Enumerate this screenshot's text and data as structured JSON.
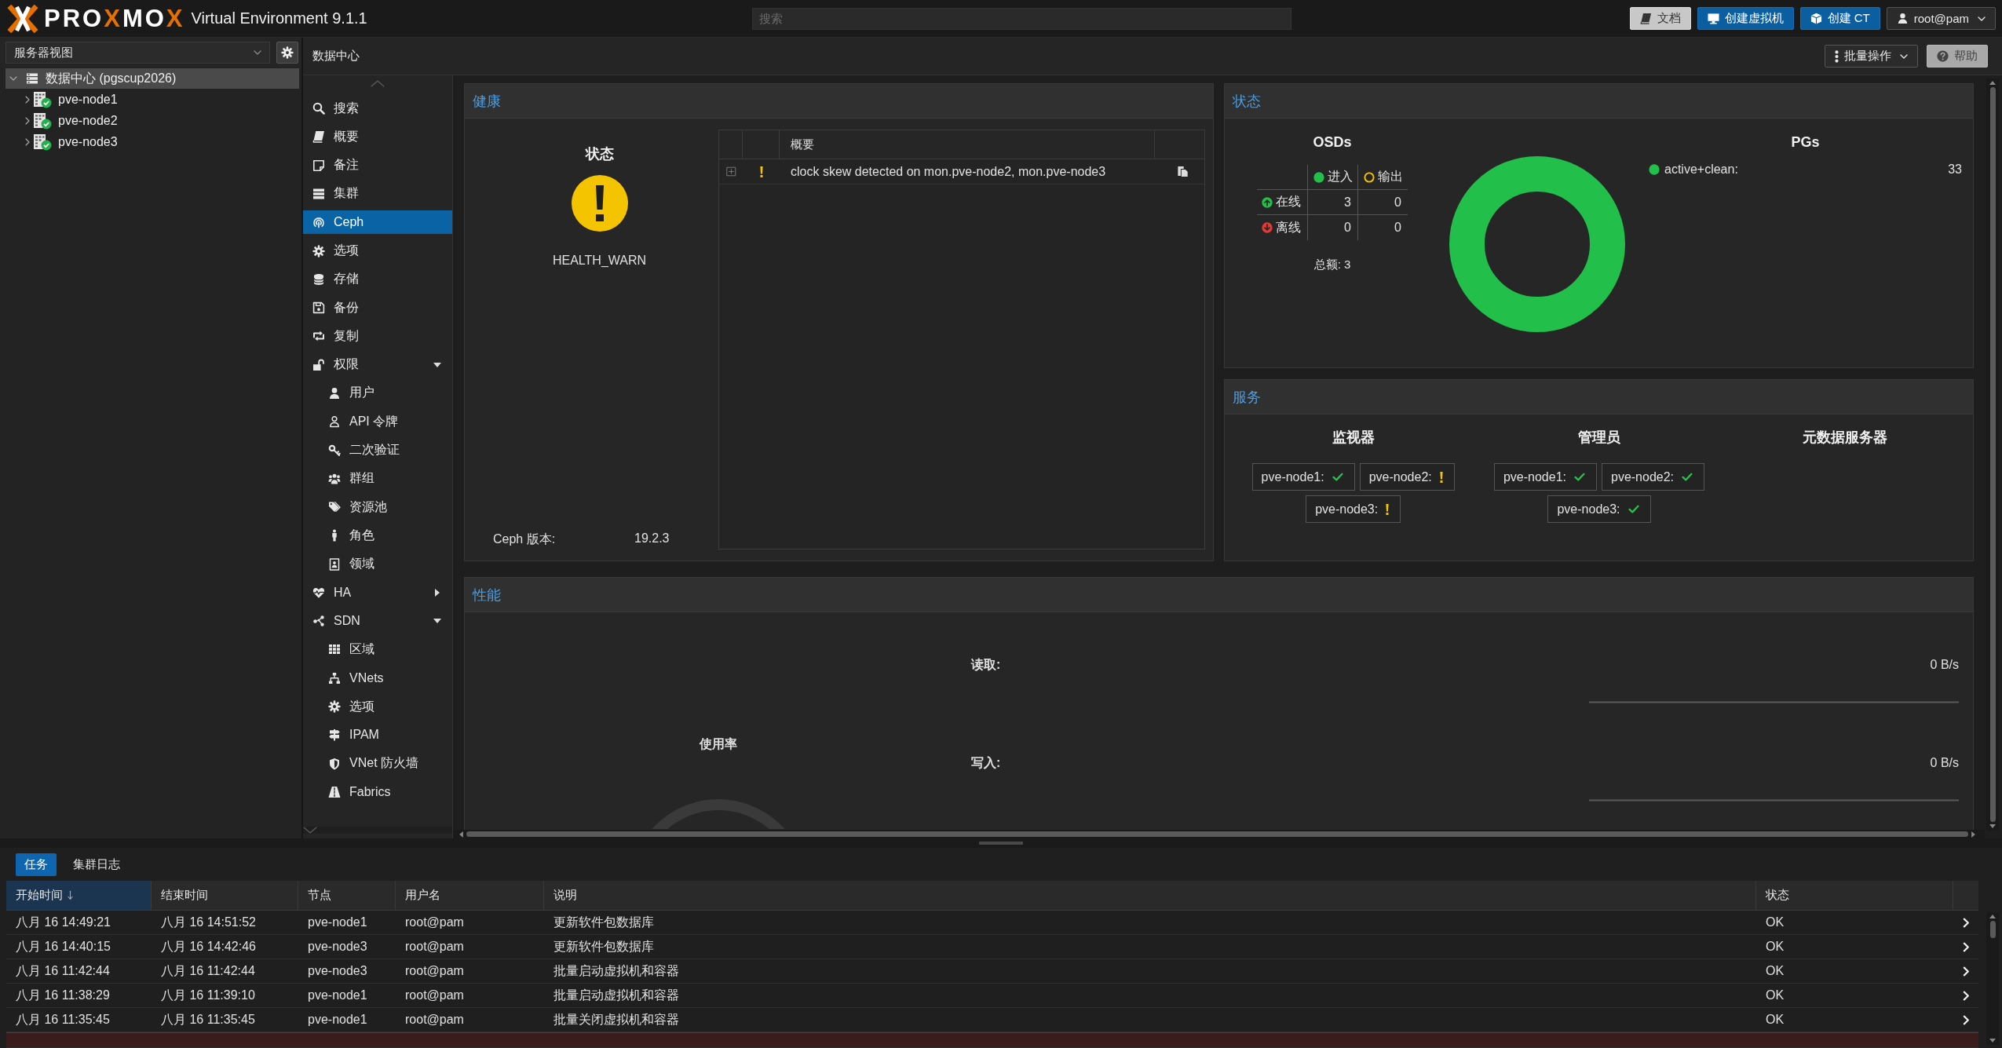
{
  "header": {
    "logo": {
      "parts": [
        {
          "text": "PRO",
          "accent": false
        },
        {
          "text": "X",
          "accent": true
        },
        {
          "text": "MO",
          "accent": false
        },
        {
          "text": "X",
          "accent": true
        }
      ]
    },
    "product": "Virtual Environment 9.1.1",
    "search": {
      "placeholder": "搜索"
    },
    "buttons": [
      {
        "label": "文档",
        "kind": "docs"
      },
      {
        "label": "创建虚拟机",
        "kind": "create_vm"
      },
      {
        "label": "创建 CT",
        "kind": "create_ct"
      },
      {
        "label": "root@pam",
        "kind": "user"
      }
    ]
  },
  "sidebar": {
    "view_selector": {
      "value": "服务器视图"
    },
    "tree": [
      {
        "label": "数据中心 (pgscup2026)",
        "kind": "datacenter",
        "expanded": true,
        "selected": true,
        "children": [
          {
            "label": "pve-node1",
            "kind": "node",
            "expanded": false,
            "selected": false,
            "online": true
          },
          {
            "label": "pve-node2",
            "kind": "node",
            "expanded": false,
            "selected": false,
            "online": true
          },
          {
            "label": "pve-node3",
            "kind": "node",
            "expanded": false,
            "selected": false,
            "online": true
          }
        ]
      }
    ]
  },
  "toolbar": {
    "breadcrumb": "数据中心",
    "buttons": [
      {
        "label": "批量操作",
        "kind": "bulk"
      },
      {
        "label": "帮助",
        "kind": "help"
      }
    ]
  },
  "nav_menu": [
    {
      "label": "搜索",
      "kind": "search",
      "selected": false
    },
    {
      "label": "概要",
      "kind": "summary",
      "selected": false
    },
    {
      "label": "备注",
      "kind": "notes",
      "selected": false
    },
    {
      "label": "集群",
      "kind": "cluster",
      "selected": false
    },
    {
      "label": "Ceph",
      "kind": "ceph",
      "selected": true
    },
    {
      "label": "选项",
      "kind": "options",
      "selected": false
    },
    {
      "label": "存储",
      "kind": "storage",
      "selected": false
    },
    {
      "label": "备份",
      "kind": "backup",
      "selected": false
    },
    {
      "label": "复制",
      "kind": "replication",
      "selected": false
    },
    {
      "label": "权限",
      "kind": "permissions",
      "selected": false,
      "expanded": true,
      "children": [
        {
          "label": "用户",
          "kind": "users",
          "selected": false
        },
        {
          "label": "API 令牌",
          "kind": "tokens",
          "selected": false
        },
        {
          "label": "二次验证",
          "kind": "tfa",
          "selected": false
        },
        {
          "label": "群组",
          "kind": "groups",
          "selected": false
        },
        {
          "label": "资源池",
          "kind": "pools",
          "selected": false
        },
        {
          "label": "角色",
          "kind": "roles",
          "selected": false
        },
        {
          "label": "领域",
          "kind": "realms",
          "selected": false
        }
      ]
    },
    {
      "label": "HA",
      "kind": "ha",
      "selected": false,
      "expanded": false
    },
    {
      "label": "SDN",
      "kind": "sdn",
      "selected": false,
      "expanded": true,
      "children": [
        {
          "label": "区域",
          "kind": "zones",
          "selected": false
        },
        {
          "label": "VNets",
          "kind": "vnets",
          "selected": false
        },
        {
          "label": "选项",
          "kind": "options",
          "selected": false
        },
        {
          "label": "IPAM",
          "kind": "ipam",
          "selected": false
        },
        {
          "label": "VNet 防火墙",
          "kind": "firewall",
          "selected": false
        },
        {
          "label": "Fabrics",
          "kind": "fabrics",
          "selected": false
        }
      ]
    }
  ],
  "health": {
    "title": "健康",
    "status_heading": "状态",
    "status": "HEALTH_WARN",
    "warning": true,
    "version_label": "Ceph 版本:",
    "version": "19.2.3",
    "table": {
      "columns": [
        "概要"
      ],
      "rows": [
        {
          "expanded": false,
          "kind": "warning",
          "summary": "clock skew detected on mon.pve-node2, mon.pve-node3"
        }
      ]
    }
  },
  "status": {
    "title": "状态",
    "osds": {
      "heading": "OSDs",
      "columns": [
        {
          "label": "进入",
          "kind": "in"
        },
        {
          "label": "输出",
          "kind": "out"
        }
      ],
      "rows": [
        {
          "label": "在线",
          "kind": "up",
          "values": [
            "3",
            "0"
          ]
        },
        {
          "label": "离线",
          "kind": "down",
          "values": [
            "0",
            "0"
          ]
        }
      ],
      "total": "总额: 3"
    },
    "pgs": {
      "heading": "PGs",
      "legend": [
        {
          "label": "active+clean:",
          "count": "33",
          "color": "#22c04a"
        }
      ]
    }
  },
  "services": {
    "title": "服务",
    "groups": [
      {
        "heading": "监视器",
        "items": [
          {
            "label": "pve-node1:",
            "kind": "ok"
          },
          {
            "label": "pve-node2:",
            "kind": "warning"
          },
          {
            "label": "pve-node3:",
            "kind": "warning"
          }
        ]
      },
      {
        "heading": "管理员",
        "items": [
          {
            "label": "pve-node1:",
            "kind": "ok"
          },
          {
            "label": "pve-node2:",
            "kind": "ok"
          },
          {
            "label": "pve-node3:",
            "kind": "ok"
          }
        ]
      },
      {
        "heading": "元数据服务器"
      }
    ]
  },
  "performance": {
    "title": "性能",
    "usage_label": "使用率",
    "metrics": [
      {
        "label": "读取:",
        "value": "0 B/s"
      },
      {
        "label": "写入:",
        "value": "0 B/s"
      }
    ]
  },
  "task_log": {
    "tabs": [
      {
        "label": "任务",
        "selected": true
      },
      {
        "label": "集群日志",
        "selected": false
      }
    ],
    "columns": [
      {
        "label": "开始时间",
        "sorted": true
      },
      {
        "label": "结束时间",
        "sorted": false
      },
      {
        "label": "节点",
        "sorted": false
      },
      {
        "label": "用户名",
        "sorted": false
      },
      {
        "label": "说明",
        "sorted": false
      },
      {
        "label": "状态",
        "sorted": false
      }
    ],
    "rows": [
      {
        "start": "八月 16 14:49:21",
        "end": "八月 16 14:51:52",
        "node": "pve-node1",
        "user": "root@pam",
        "description": "更新软件包数据库",
        "status": "OK",
        "error": false
      },
      {
        "start": "八月 16 14:40:15",
        "end": "八月 16 14:42:46",
        "node": "pve-node3",
        "user": "root@pam",
        "description": "更新软件包数据库",
        "status": "OK",
        "error": false
      },
      {
        "start": "八月 16 11:42:44",
        "end": "八月 16 11:42:44",
        "node": "pve-node3",
        "user": "root@pam",
        "description": "批量启动虚拟机和容器",
        "status": "OK",
        "error": false
      },
      {
        "start": "八月 16 11:38:29",
        "end": "八月 16 11:39:10",
        "node": "pve-node1",
        "user": "root@pam",
        "description": "批量启动虚拟机和容器",
        "status": "OK",
        "error": false
      },
      {
        "start": "八月 16 11:35:45",
        "end": "八月 16 11:35:45",
        "node": "pve-node1",
        "user": "root@pam",
        "description": "批量关闭虚拟机和容器",
        "status": "OK",
        "error": false
      }
    ],
    "partial_row": {
      "error": true
    }
  }
}
